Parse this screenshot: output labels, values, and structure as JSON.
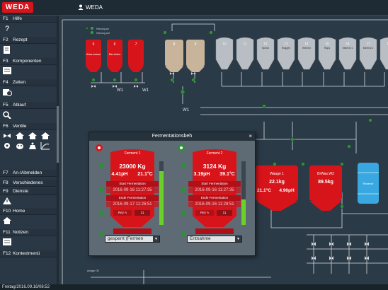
{
  "app": {
    "logo": "WEDA",
    "user": "WEDA"
  },
  "sidebar": [
    {
      "key": "F1",
      "label": "Hilfe",
      "icons": [
        "help-icon"
      ]
    },
    {
      "key": "F2",
      "label": "Rezept",
      "icons": [
        "recipe-icon"
      ]
    },
    {
      "key": "F3",
      "label": "Komponenten",
      "icons": [
        "components-icon"
      ]
    },
    {
      "key": "F4",
      "label": "Zeiten",
      "icons": [
        "clock-calendar-icon"
      ]
    },
    {
      "key": "F5",
      "label": "Ablauf",
      "icons": [
        "magnifier-icon"
      ]
    },
    {
      "key": "F6",
      "label": "Ventile",
      "icons": [
        "valve-icon",
        "house-icon",
        "house-icon-2",
        "house-icon-3",
        "gear-flow-icon",
        "cow-icon",
        "scale-icon",
        "chart-icon"
      ]
    },
    {
      "key": "F7",
      "label": "An-/Abmelden",
      "icons": []
    },
    {
      "key": "F8",
      "label": "Verschiedenes",
      "icons": []
    },
    {
      "key": "F9",
      "label": "Dienste",
      "icons": [
        "warning-icon"
      ]
    },
    {
      "key": "F10",
      "label": "Home",
      "icons": [
        "home-icon"
      ]
    },
    {
      "key": "F11",
      "label": "Notizen",
      "icons": [
        "notes-icon"
      ]
    },
    {
      "key": "F12",
      "label": "Kontextmenü",
      "icons": []
    }
  ],
  "status_bar": "Freitag/2016.09.16/08:52",
  "tanks_red": [
    {
      "id": "5",
      "name": "Heiss-wasser"
    },
    {
      "id": "6",
      "name": "Bier-treber"
    },
    {
      "id": "7",
      "name": ""
    }
  ],
  "tanks_beige": [
    {
      "id": "8",
      "name": ""
    },
    {
      "id": "9",
      "name": ""
    }
  ],
  "silos": [
    {
      "id": "10",
      "name": ""
    },
    {
      "id": "11",
      "name": ""
    },
    {
      "id": "12",
      "name": "Sprotz"
    },
    {
      "id": "13",
      "name": "Roggen"
    },
    {
      "id": "14",
      "name": "Weizen"
    },
    {
      "id": "15",
      "name": "Raps"
    },
    {
      "id": "16",
      "name": "Mineral 1"
    },
    {
      "id": "17",
      "name": "Mineral 2"
    },
    {
      "id": "18",
      "name": ""
    }
  ],
  "labels": {
    "heizung_an": "Heizung an",
    "heizung_auf": "Heizung auf",
    "anlage_ok": "Anlage OK",
    "w1": "W1",
    "vt": "VT"
  },
  "waage1": {
    "name": "Waage 1",
    "weight": "22.1kg",
    "temp": "21.1°C",
    "ph": "4.90pH"
  },
  "waage2": {
    "name": "BrWas.W2",
    "weight": "89.5kg"
  },
  "reserve": {
    "name": "Reserve"
  },
  "faceplate": {
    "title": "Fermentationsbeh",
    "close": "×",
    "tanks": [
      {
        "name": "Ferment 1",
        "weight": "23000 Kg",
        "ph": "4.41pH",
        "temp": "21.1°C",
        "start_label": "Start Fermentation",
        "start_ts": "2016-09-16 11:27:35",
        "end_label": "Ende Fermentation",
        "end_ts": "2016-09-17 11:26:51",
        "footer": "Rez A",
        "footer_val": "11",
        "state": "gesperrt (Fermen",
        "level_pct": 85
      },
      {
        "name": "Ferment 2",
        "weight": "3124 Kg",
        "ph": "3.19pH",
        "temp": "39.1°C",
        "start_label": "Start Fermentation",
        "start_ts": "2016-09-16 11:27:35",
        "end_label": "Ende Fermentation",
        "end_ts": "2016-09-16 11:28:51",
        "footer": "Rez A",
        "footer_val": "11",
        "state": "Entnahme",
        "level_pct": 40
      }
    ]
  },
  "colors": {
    "accent": "#d8141b",
    "bg": "#2b3a47",
    "green": "#2f8f3a",
    "beige": "#c8b49a",
    "silo": "#b8bec4"
  }
}
